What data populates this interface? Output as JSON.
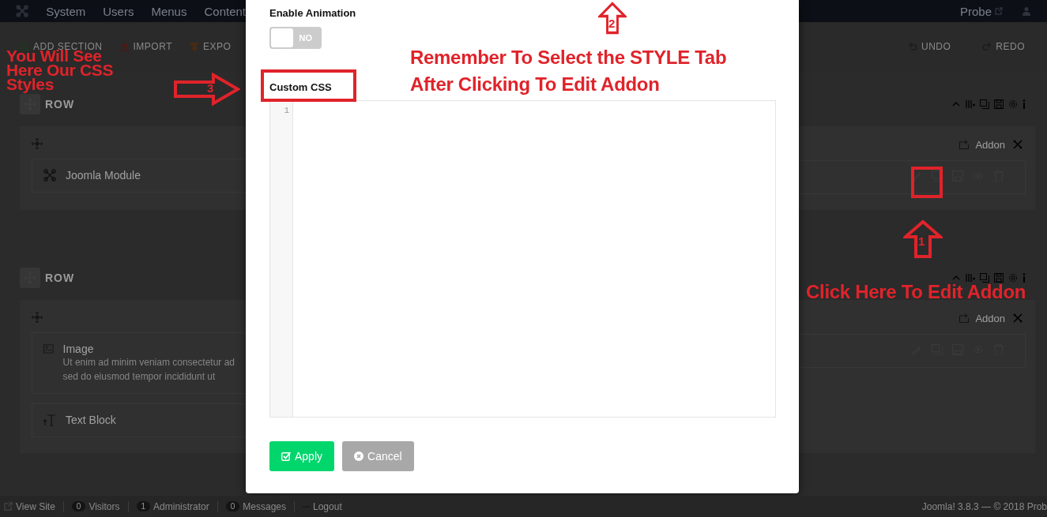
{
  "top_menu": {
    "items": [
      "System",
      "Users",
      "Menus",
      "Content"
    ],
    "site_link": "Probe"
  },
  "toolbar": {
    "left": [
      {
        "kind": "add",
        "label": "ADD SECTION"
      },
      {
        "kind": "import",
        "label": "IMPORT"
      },
      {
        "kind": "export",
        "label": "EXPO"
      }
    ],
    "right": [
      {
        "kind": "undo",
        "label": "UNDO"
      },
      {
        "kind": "redo",
        "label": "REDO"
      }
    ]
  },
  "sections": [
    {
      "label": "ROW",
      "addon_button": "Addon",
      "addons": [
        {
          "kind": "module",
          "title": "Joomla Module"
        }
      ]
    },
    {
      "label": "ROW",
      "addon_button": "Addon",
      "addons": [
        {
          "kind": "image",
          "title": "Image",
          "description_lines": [
            "Ut enim ad minim veniam consectetur ad",
            "sed do eiusmod tempor incididunt ut"
          ]
        },
        {
          "kind": "text",
          "title": "Text Block"
        }
      ]
    }
  ],
  "modal": {
    "animation_label": "Enable Animation",
    "animation_toggle": {
      "on": false,
      "text": "NO"
    },
    "css_label": "Custom CSS",
    "editor_line_numbers": [
      "1"
    ],
    "buttons": [
      {
        "kind": "apply",
        "label": "Apply"
      },
      {
        "kind": "cancel",
        "label": "Cancel"
      }
    ]
  },
  "annotations": {
    "notes": [
      "You Will See Here Our CSS Styles",
      "Remember To Select the STYLE Tab After Clicking To Edit Addon",
      "Click Here To Edit Addon"
    ],
    "arrows": [
      {
        "kind": "up",
        "number": "1"
      },
      {
        "kind": "up",
        "number": "2"
      },
      {
        "kind": "right",
        "number": "3"
      }
    ]
  },
  "status_bar": {
    "items": [
      {
        "kind": "link",
        "label": "View Site"
      },
      {
        "kind": "count",
        "count": "0",
        "label": "Visitors"
      },
      {
        "kind": "count",
        "count": "1",
        "label": "Administrator"
      },
      {
        "kind": "count",
        "count": "0",
        "label": "Messages"
      },
      {
        "kind": "logout",
        "label": "Logout"
      }
    ],
    "footer": "Joomla! 3.8.3 — © 2018 Prob"
  }
}
